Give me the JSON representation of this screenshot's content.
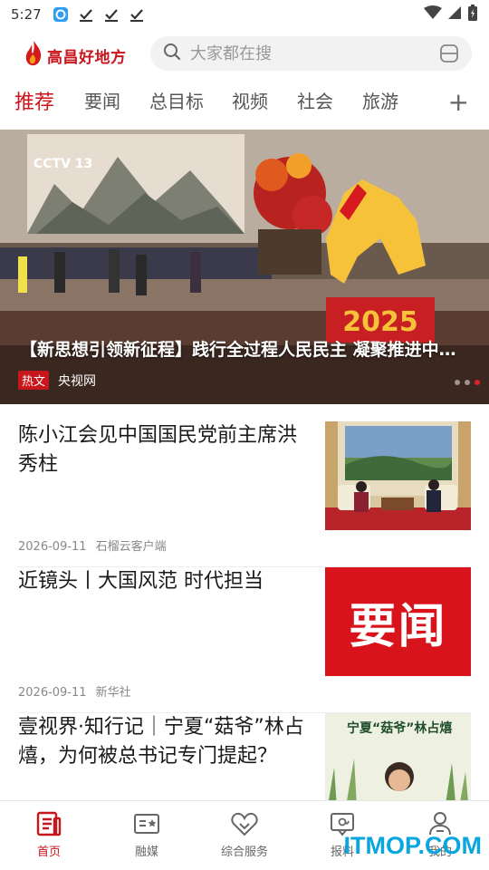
{
  "status_bar": {
    "time": "5:27"
  },
  "header": {
    "logo_text": "高昌好地方",
    "search_placeholder": "大家都在搜"
  },
  "tabs": [
    {
      "label": "推荐",
      "active": true
    },
    {
      "label": "要闻"
    },
    {
      "label": "总目标"
    },
    {
      "label": "视频"
    },
    {
      "label": "社会"
    },
    {
      "label": "旅游"
    }
  ],
  "tab_add_label": "+",
  "banner": {
    "title": "【新思想引领新征程】践行全过程人民民主 凝聚推进中国式现代化强大力量",
    "badge": "热文",
    "source": "央视网",
    "dots": 3,
    "active_dot": 2
  },
  "news": [
    {
      "title": "陈小江会见中国国民党前主席洪秀柱",
      "date": "2026-09-11",
      "source": "石榴云客户端",
      "thumb": "meeting-photo"
    },
    {
      "title": "近镜头丨大国风范 时代担当",
      "date": "2026-09-11",
      "source": "新华社",
      "thumb": "要闻"
    },
    {
      "title": "壹视界·知行记｜宁夏“菇爷”林占熺，为何被总书记专门提起？",
      "date": "",
      "source": "",
      "thumb": "宁夏“菇爷”林占熺"
    }
  ],
  "bottom_nav": [
    {
      "label": "首页",
      "icon": "home-icon",
      "active": true
    },
    {
      "label": "融媒",
      "icon": "media-icon"
    },
    {
      "label": "综合服务",
      "icon": "service-icon"
    },
    {
      "label": "报料",
      "icon": "report-icon"
    },
    {
      "label": "我的",
      "icon": "user-icon"
    }
  ],
  "watermark": "ITMOP.COM",
  "colors": {
    "accent": "#c8161d",
    "tab_active": "#d0121b",
    "watermark": "#0aa6e0"
  }
}
